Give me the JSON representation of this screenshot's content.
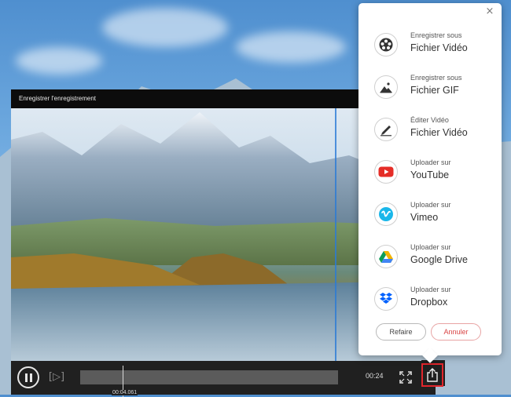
{
  "window": {
    "title": "Enregistrer l'enregistrement"
  },
  "player": {
    "current_time": "00:04.061",
    "duration": "00:24",
    "frame_button_label": "[▷]"
  },
  "export_menu": {
    "items": [
      {
        "small": "Enregistrer sous",
        "big": "Fichier Vidéo",
        "icon": "film-reel-icon"
      },
      {
        "small": "Enregistrer sous",
        "big": "Fichier GIF",
        "icon": "image-icon"
      },
      {
        "small": "Éditer Vidéo",
        "big": "Fichier Vidéo",
        "icon": "edit-pen-icon"
      },
      {
        "small": "Uploader sur",
        "big": "YouTube",
        "icon": "youtube-icon"
      },
      {
        "small": "Uploader sur",
        "big": "Vimeo",
        "icon": "vimeo-icon"
      },
      {
        "small": "Uploader sur",
        "big": "Google Drive",
        "icon": "google-drive-icon"
      },
      {
        "small": "Uploader sur",
        "big": "Dropbox",
        "icon": "dropbox-icon"
      }
    ],
    "close_label": "×",
    "redo_label": "Refaire",
    "cancel_label": "Annuler"
  },
  "colors": {
    "accent_red": "#e2262c",
    "youtube_red": "#e52d27",
    "vimeo_blue": "#1ab7ea",
    "dropbox_blue": "#0061fe",
    "trim_line_blue": "#2a7bd6"
  }
}
